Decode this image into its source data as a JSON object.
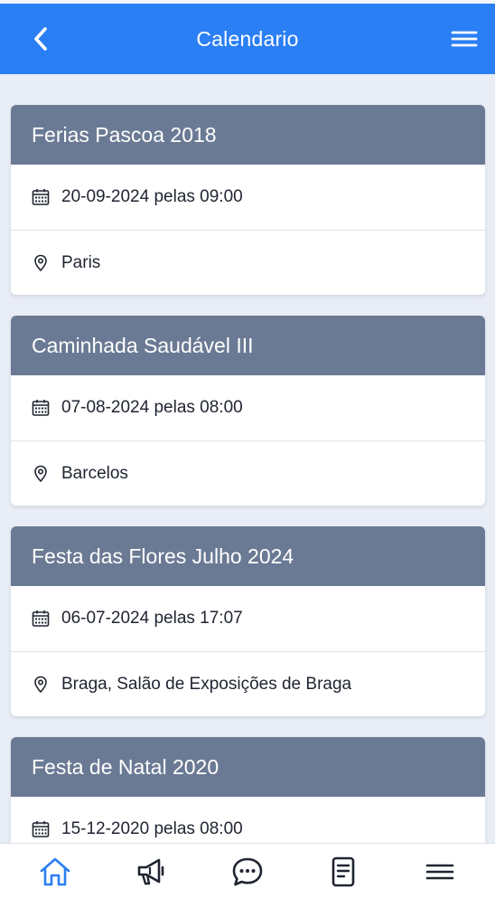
{
  "header": {
    "title": "Calendario",
    "back_icon": "chevron-left-icon",
    "menu_icon": "hamburger-menu-icon",
    "color": "#2b7ff4"
  },
  "events": [
    {
      "title": "Ferias Pascoa 2018",
      "datetime": "20-09-2024 pelas 09:00",
      "location": "Paris"
    },
    {
      "title": "Caminhada Saudável III",
      "datetime": "07-08-2024 pelas 08:00",
      "location": "Barcelos"
    },
    {
      "title": "Festa das Flores Julho 2024",
      "datetime": "06-07-2024 pelas 17:07",
      "location": "Braga, Salão de Exposições de Braga"
    },
    {
      "title": "Festa de Natal 2020",
      "datetime": "15-12-2020 pelas 08:00",
      "location": ""
    }
  ],
  "bottom_nav": {
    "items": [
      {
        "icon": "home-icon",
        "active": true
      },
      {
        "icon": "megaphone-icon",
        "active": false
      },
      {
        "icon": "chat-bubble-icon",
        "active": false
      },
      {
        "icon": "document-icon",
        "active": false
      },
      {
        "icon": "hamburger-menu-icon",
        "active": false
      }
    ],
    "active_color": "#2b7ff4",
    "inactive_color": "#1f2430"
  },
  "colors": {
    "card_header": "#6b7a94",
    "background": "#e9edf5"
  }
}
